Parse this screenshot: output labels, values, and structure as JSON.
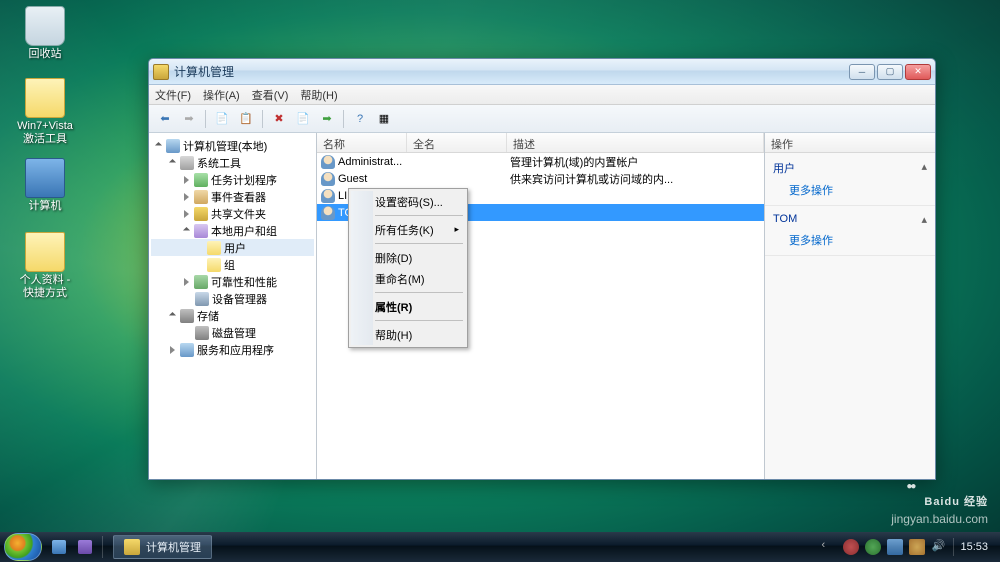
{
  "desktop": {
    "recyclebin": "回收站",
    "folder1_l1": "Win7+Vista",
    "folder1_l2": "激活工具",
    "computer": "计算机",
    "folder2_l1": "个人资料 -",
    "folder2_l2": "快捷方式"
  },
  "window": {
    "title": "计算机管理",
    "menu": {
      "file": "文件(F)",
      "action": "操作(A)",
      "view": "查看(V)",
      "help": "帮助(H)"
    }
  },
  "tree": {
    "root": "计算机管理(本地)",
    "systools": "系统工具",
    "scheduler": "任务计划程序",
    "eventviewer": "事件查看器",
    "shared": "共享文件夹",
    "localusers": "本地用户和组",
    "users": "用户",
    "groups": "组",
    "perf": "可靠性和性能",
    "devmgr": "设备管理器",
    "storage": "存储",
    "diskmgmt": "磁盘管理",
    "services": "服务和应用程序"
  },
  "list": {
    "headers": {
      "name": "名称",
      "fullname": "全名",
      "desc": "描述"
    },
    "rows": [
      {
        "name": "Administrat...",
        "fullname": "",
        "desc": "管理计算机(域)的内置帐户"
      },
      {
        "name": "Guest",
        "fullname": "",
        "desc": "供来宾访问计算机或访问域的内..."
      },
      {
        "name": "LINsir",
        "fullname": "LINsir",
        "desc": ""
      },
      {
        "name": "TOM",
        "fullname": "",
        "desc": ""
      }
    ]
  },
  "actions": {
    "header": "操作",
    "sec1_title": "用户",
    "sec2_title": "TOM",
    "more": "更多操作"
  },
  "context": {
    "setpwd": "设置密码(S)...",
    "alltasks": "所有任务(K)",
    "delete": "删除(D)",
    "rename": "重命名(M)",
    "props": "属性(R)",
    "help": "帮助(H)"
  },
  "taskbar": {
    "app": "计算机管理",
    "time": "15:53"
  },
  "watermark": {
    "brand": "Baidu 经验",
    "url": "jingyan.baidu.com"
  }
}
